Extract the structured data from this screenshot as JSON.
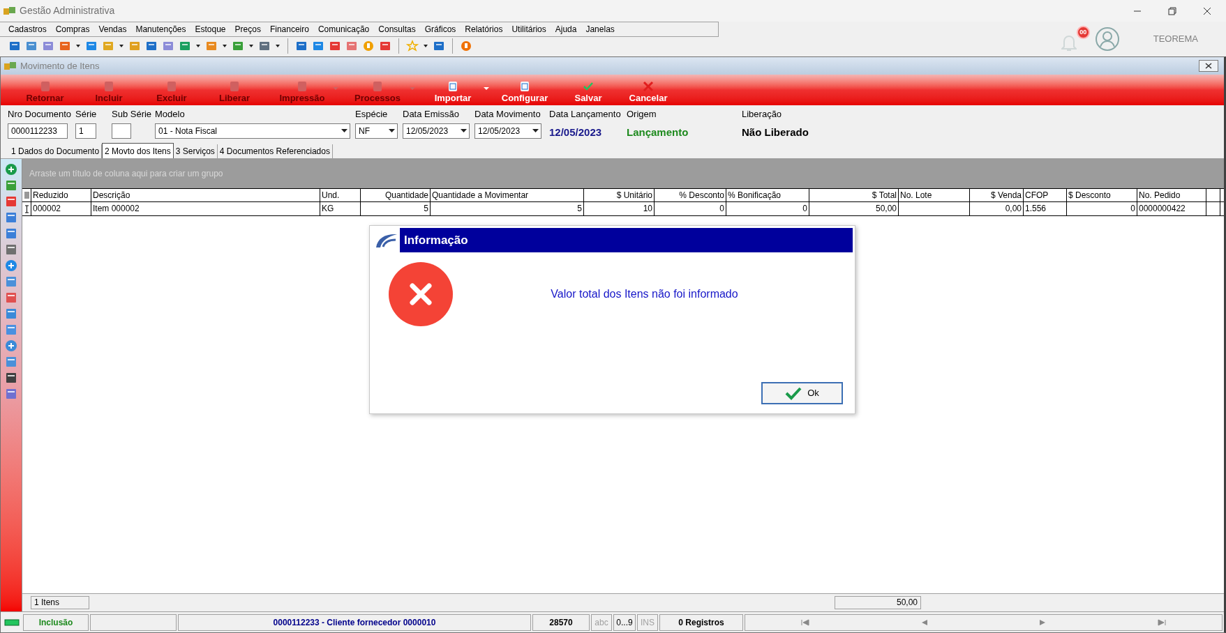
{
  "window": {
    "title": "Gestão Administrativa"
  },
  "menu": [
    "Cadastros",
    "Compras",
    "Vendas",
    "Manutenções",
    "Estoque",
    "Preços",
    "Financeiro",
    "Comunicação",
    "Consultas",
    "Gráficos",
    "Relatórios",
    "Utilitários",
    "Ajuda",
    "Janelas"
  ],
  "notifications": {
    "badge": "00"
  },
  "user": {
    "name": "TEOREMA"
  },
  "child_window": {
    "title": "Movimento de Itens"
  },
  "toolbar": [
    {
      "label": "Retornar",
      "disabled": true,
      "dropdown": false
    },
    {
      "label": "Incluir",
      "disabled": true,
      "dropdown": false
    },
    {
      "label": "Excluir",
      "disabled": true,
      "dropdown": false
    },
    {
      "label": "Liberar",
      "disabled": true,
      "dropdown": false
    },
    {
      "label": "Impressão",
      "disabled": true,
      "dropdown": true
    },
    {
      "label": "Processos",
      "disabled": true,
      "dropdown": true
    },
    {
      "label": "Importar",
      "disabled": false,
      "dropdown": true
    },
    {
      "label": "Configurar",
      "disabled": false,
      "dropdown": false
    },
    {
      "label": "Salvar",
      "disabled": false,
      "dropdown": false
    },
    {
      "label": "Cancelar",
      "disabled": false,
      "dropdown": false
    }
  ],
  "header_fields": [
    {
      "kind": "text",
      "label": "Nro Documento",
      "value": "0000112233"
    },
    {
      "kind": "text",
      "label": "Série",
      "value": "1"
    },
    {
      "kind": "text",
      "label": "Sub Série"
    },
    {
      "kind": "select",
      "label": "Modelo",
      "value": "01 - Nota Fiscal"
    },
    {
      "kind": "select",
      "label": "Espécie",
      "value": "NF"
    },
    {
      "kind": "select",
      "label": "Data Emissão",
      "value": "12/05/2023"
    },
    {
      "kind": "select",
      "label": "Data Movimento",
      "value": "12/05/2023"
    },
    {
      "kind": "display",
      "label": "Data Lançamento",
      "value": "12/05/2023",
      "color": "#1a1a8c"
    },
    {
      "kind": "display",
      "label": "Origem",
      "value": "Lançamento",
      "color": "#1e8a1e"
    },
    {
      "kind": "display",
      "label": "Liberação",
      "value": "Não Liberado",
      "color": "#000000"
    }
  ],
  "tabs": [
    {
      "label": "1 Dados do Documento",
      "selected": false
    },
    {
      "label": "2 Movto dos Itens",
      "selected": true
    },
    {
      "label": "3 Serviços",
      "selected": false
    },
    {
      "label": "4 Documentos Referenciados",
      "selected": false
    }
  ],
  "grid": {
    "group_hint": "Arraste um título de coluna aqui para criar um grupo",
    "columns": [
      "Reduzido",
      "Descrição",
      "Und.",
      "Quantidade",
      "Quantidade a Movimentar",
      "$ Unitário",
      "% Desconto",
      "% Bonificação",
      "$ Total",
      "No. Lote",
      "$ Venda",
      "CFOP",
      "$ Desconto",
      "No. Pedido"
    ],
    "rows": [
      {
        "cells": [
          "000002",
          "Item 000002",
          "KG",
          "5",
          "5",
          "10",
          "0",
          "0",
          "50,00",
          "",
          "0,00",
          "1.556",
          "0",
          "0000000422"
        ]
      }
    ]
  },
  "dialog": {
    "title": "Informação",
    "message": "Valor total dos Itens não foi informado",
    "button": "Ok"
  },
  "footer": {
    "count": "1 Itens",
    "total": "50,00"
  },
  "status_bar": {
    "mode": "Inclusão",
    "document": "0000112233 - Cliente fornecedor 0000010",
    "code": "28570",
    "abc": "abc",
    "digits": "0...9",
    "ins": "INS",
    "records": "0 Registros"
  }
}
